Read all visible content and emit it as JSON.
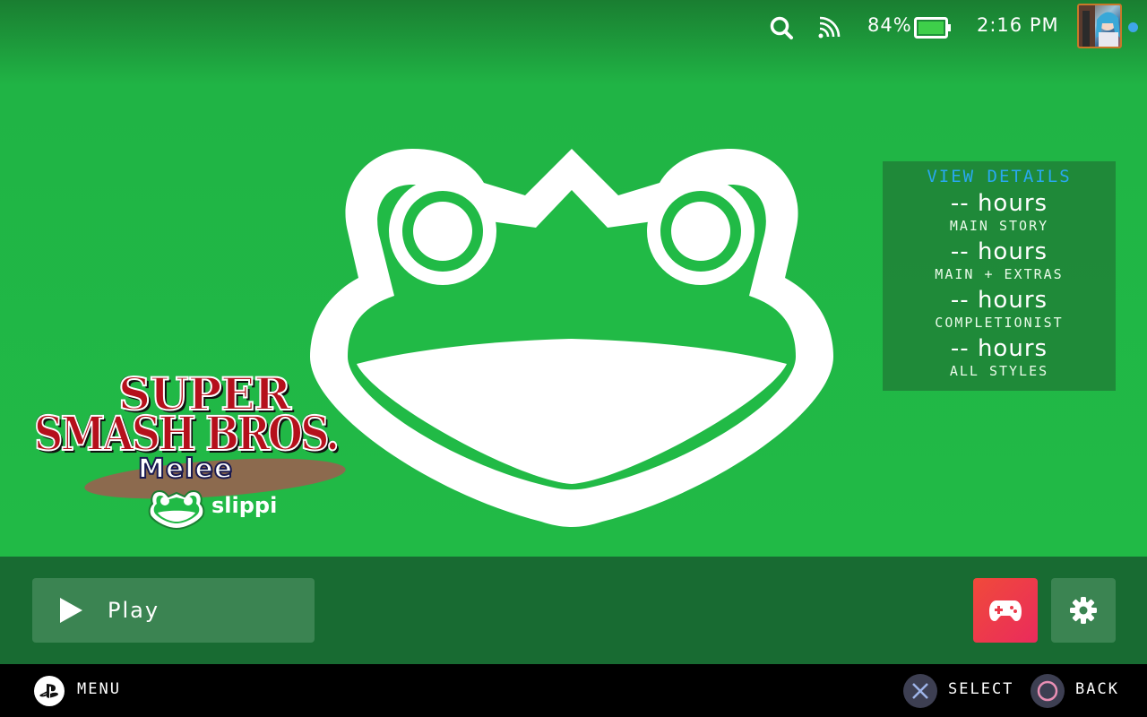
{
  "status_bar": {
    "battery_percent": "84%",
    "battery_level": 0.84,
    "time": "2:16 PM",
    "icons": [
      "search-icon",
      "wifi-signal-icon",
      "battery-icon",
      "user-avatar",
      "notification-dot"
    ]
  },
  "game": {
    "logo_line1": "SUPER",
    "logo_line2": "SMASH BROS.",
    "logo_line3": "Melee",
    "logo_slippi": "slippi"
  },
  "hltb": {
    "title": "VIEW DETAILS",
    "rows": [
      {
        "hours": "-- hours",
        "label": "MAIN STORY"
      },
      {
        "hours": "-- hours",
        "label": "MAIN + EXTRAS"
      },
      {
        "hours": "-- hours",
        "label": "COMPLETIONIST"
      },
      {
        "hours": "-- hours",
        "label": "ALL STYLES"
      }
    ]
  },
  "actions": {
    "play_label": "Play",
    "controller_icon": "gamepad-icon",
    "settings_icon": "gear-icon"
  },
  "footer": {
    "menu_label": "MENU",
    "select_label": "SELECT",
    "back_label": "BACK"
  },
  "colors": {
    "hero_green": "#21ba46",
    "action_bar": "#186b32",
    "hltb_title": "#29a8f0",
    "controller_gradient_start": "#f04a3a",
    "controller_gradient_end": "#ea2b5c"
  }
}
